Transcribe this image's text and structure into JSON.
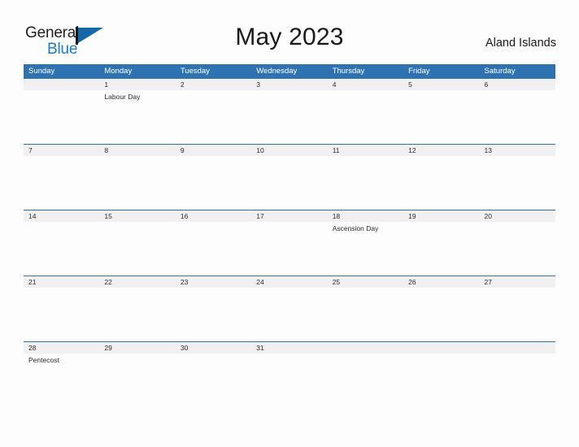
{
  "brand": {
    "name_part1": "General",
    "name_part2": "Blue",
    "mark": "flag-triangle-icon"
  },
  "header": {
    "title": "May 2023",
    "locale": "Aland Islands"
  },
  "calendar": {
    "weekday_headers": [
      "Sunday",
      "Monday",
      "Tuesday",
      "Wednesday",
      "Thursday",
      "Friday",
      "Saturday"
    ],
    "weeks": [
      {
        "days": [
          {
            "num": "",
            "event": ""
          },
          {
            "num": "1",
            "event": "Labour Day"
          },
          {
            "num": "2",
            "event": ""
          },
          {
            "num": "3",
            "event": ""
          },
          {
            "num": "4",
            "event": ""
          },
          {
            "num": "5",
            "event": ""
          },
          {
            "num": "6",
            "event": ""
          }
        ]
      },
      {
        "days": [
          {
            "num": "7",
            "event": ""
          },
          {
            "num": "8",
            "event": ""
          },
          {
            "num": "9",
            "event": ""
          },
          {
            "num": "10",
            "event": ""
          },
          {
            "num": "11",
            "event": ""
          },
          {
            "num": "12",
            "event": ""
          },
          {
            "num": "13",
            "event": ""
          }
        ]
      },
      {
        "days": [
          {
            "num": "14",
            "event": ""
          },
          {
            "num": "15",
            "event": ""
          },
          {
            "num": "16",
            "event": ""
          },
          {
            "num": "17",
            "event": ""
          },
          {
            "num": "18",
            "event": "Ascension Day"
          },
          {
            "num": "19",
            "event": ""
          },
          {
            "num": "20",
            "event": ""
          }
        ]
      },
      {
        "days": [
          {
            "num": "21",
            "event": ""
          },
          {
            "num": "22",
            "event": ""
          },
          {
            "num": "23",
            "event": ""
          },
          {
            "num": "24",
            "event": ""
          },
          {
            "num": "25",
            "event": ""
          },
          {
            "num": "26",
            "event": ""
          },
          {
            "num": "27",
            "event": ""
          }
        ]
      },
      {
        "days": [
          {
            "num": "28",
            "event": "Pentecost"
          },
          {
            "num": "29",
            "event": ""
          },
          {
            "num": "30",
            "event": ""
          },
          {
            "num": "31",
            "event": ""
          },
          {
            "num": "",
            "event": ""
          },
          {
            "num": "",
            "event": ""
          },
          {
            "num": "",
            "event": ""
          }
        ]
      }
    ]
  },
  "colors": {
    "header_blue": "#2E72B3",
    "brand_blue": "#1B7BC4",
    "mark_blue": "#1567A8",
    "date_band_gray": "#F0F0F0",
    "page_background": "#FDFDFD",
    "text_dark": "#1A1A1A"
  }
}
